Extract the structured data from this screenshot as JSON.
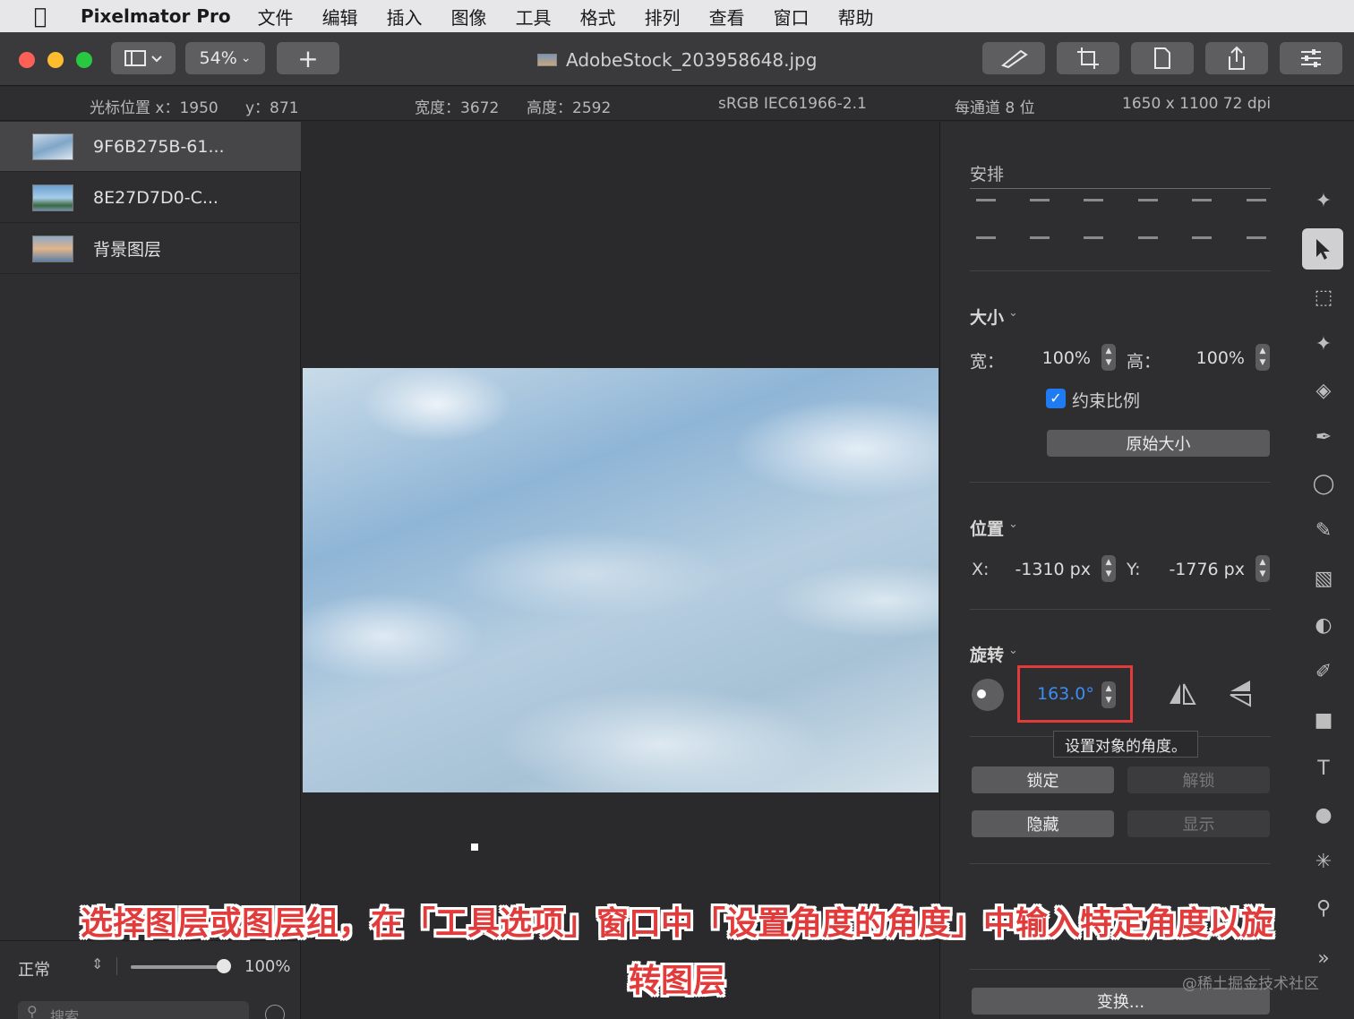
{
  "menubar": {
    "app_name": "Pixelmator Pro",
    "items": [
      "文件",
      "编辑",
      "插入",
      "图像",
      "工具",
      "格式",
      "排列",
      "查看",
      "窗口",
      "帮助"
    ]
  },
  "toolbar": {
    "zoom": "54%",
    "add": "+",
    "document_title": "AdobeStock_203958648.jpg"
  },
  "infobar": {
    "cursor_x": "光标位置 x：1950",
    "cursor_y": "y：871",
    "width": "宽度：3672",
    "height": "高度：2592",
    "color_profile": "sRGB IEC61966-2.1",
    "bit_depth": "每通道 8 位",
    "resolution": "1650 x 1100 72 dpi"
  },
  "layers": [
    {
      "name": "9F6B275B-61...",
      "selected": true
    },
    {
      "name": "8E27D7D0-C...",
      "selected": false
    },
    {
      "name": "背景图层",
      "selected": false
    }
  ],
  "layers_footer": {
    "blend_mode": "正常",
    "opacity": "100%",
    "opacity_fraction": 1.0,
    "search_placeholder": "搜索"
  },
  "options": {
    "arrange_title": "安排",
    "size_title": "大小",
    "width_label": "宽：",
    "width_value": "100%",
    "height_label": "高：",
    "height_value": "100%",
    "constrain_label": "约束比例",
    "original_size_label": "原始大小",
    "position_title": "位置",
    "x_label": "X:",
    "x_value": "-1310 px",
    "y_label": "Y:",
    "y_value": "-1776 px",
    "rotate_title": "旋转",
    "angle_value": "163.0°",
    "tooltip": "设置对象的角度。",
    "lock_label": "锁定",
    "unlock_label": "解锁",
    "hide_label": "隐藏",
    "show_label": "显示",
    "transform_label": "变换..."
  },
  "caption": {
    "line1": "选择图层或图层组，在「工具选项」窗口中「设置角度的角度」中输入特定角度以旋",
    "line2": "转图层"
  },
  "watermark": "@稀土掘金技术社区",
  "colors": {
    "accent": "#1e7bf2",
    "highlight": "#e23b3b",
    "panel": "#2e2e30"
  }
}
